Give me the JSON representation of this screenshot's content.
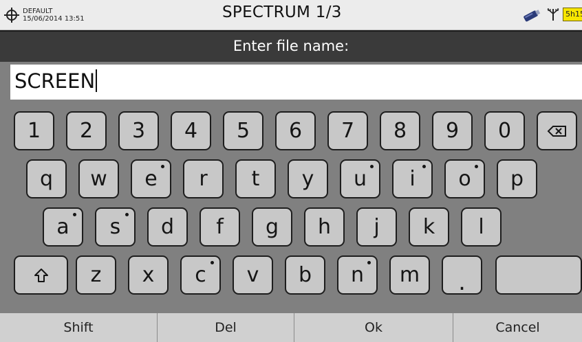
{
  "status_bar": {
    "preset_name": "DEFAULT",
    "datetime": "15/06/2014 13:51",
    "title": "SPECTRUM 1/3",
    "battery_text": "5h15",
    "icons": [
      "target-icon",
      "usb-stick-icon",
      "antenna-icon",
      "battery-badge"
    ]
  },
  "prompt": {
    "label": "Enter file name:"
  },
  "input": {
    "value": "SCREEN"
  },
  "keyboard": {
    "row1": [
      "1",
      "2",
      "3",
      "4",
      "5",
      "6",
      "7",
      "8",
      "9",
      "0",
      "backspace"
    ],
    "row2": [
      "q",
      "w",
      "e",
      "r",
      "t",
      "y",
      "u",
      "i",
      "o",
      "p"
    ],
    "row3": [
      "a",
      "s",
      "d",
      "f",
      "g",
      "h",
      "j",
      "k",
      "l"
    ],
    "row4": [
      "shift",
      "z",
      "x",
      "c",
      "v",
      "b",
      "n",
      "m",
      ".",
      ""
    ],
    "accented_keys": [
      "e",
      "u",
      "i",
      "o",
      "a",
      "s",
      "c",
      "n"
    ]
  },
  "softkeys": [
    "Shift",
    "Del",
    "Ok",
    "Cancel"
  ],
  "colors": {
    "prompt_bar": "#3a3a3a",
    "keyboard_bg": "#808080",
    "key_face": "#c8c8c8",
    "battery": "#f7e600"
  }
}
